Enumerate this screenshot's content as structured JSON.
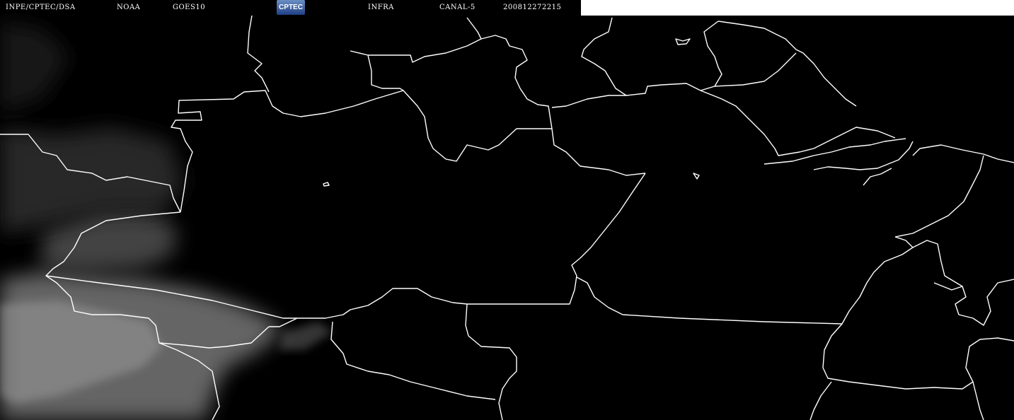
{
  "header": {
    "institution": "INPE/CPTEC/DSA",
    "agency": "NOAA",
    "satellite": "GOES10",
    "logo_text": "CPTEC",
    "band": "INFRA",
    "channel": "CANAL-5",
    "timestamp": "200812272215"
  },
  "colors": {
    "background": "#000000",
    "borders": "#ffffff",
    "clouds": "#8a8a8a"
  }
}
